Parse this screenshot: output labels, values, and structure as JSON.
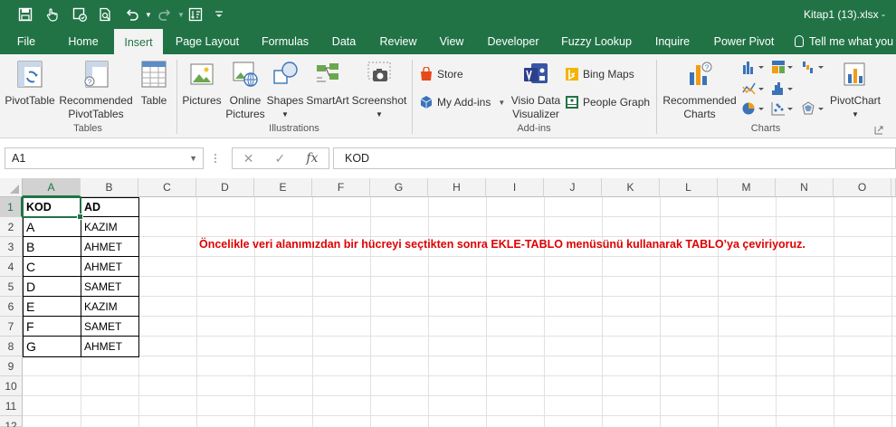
{
  "window": {
    "title": "Kitap1 (13).xlsx -"
  },
  "quick_access": {
    "icons": [
      "save-icon",
      "touch-mode-icon",
      "autosave-icon",
      "print-preview-icon",
      "undo-icon",
      "redo-icon",
      "sort-icon",
      "customize-icon"
    ]
  },
  "tabs": [
    {
      "label": "File"
    },
    {
      "label": "Home"
    },
    {
      "label": "Insert"
    },
    {
      "label": "Page Layout"
    },
    {
      "label": "Formulas"
    },
    {
      "label": "Data"
    },
    {
      "label": "Review"
    },
    {
      "label": "View"
    },
    {
      "label": "Developer"
    },
    {
      "label": "Fuzzy Lookup"
    },
    {
      "label": "Inquire"
    },
    {
      "label": "Power Pivot"
    }
  ],
  "tell_me": "Tell me what you",
  "ribbon": {
    "tables": {
      "label": "Tables",
      "pivottable": "PivotTable",
      "recommended_pivot_1": "Recommended",
      "recommended_pivot_2": "PivotTables",
      "table": "Table"
    },
    "illustrations": {
      "label": "Illustrations",
      "pictures": "Pictures",
      "online_1": "Online",
      "online_2": "Pictures",
      "shapes": "Shapes",
      "smartart": "SmartArt",
      "screenshot": "Screenshot"
    },
    "addins": {
      "label": "Add-ins",
      "store": "Store",
      "my_addins": "My Add-ins",
      "visio_1": "Visio Data",
      "visio_2": "Visualizer",
      "bing_maps": "Bing Maps",
      "people_graph": "People Graph"
    },
    "charts": {
      "label": "Charts",
      "recommended_1": "Recommended",
      "recommended_2": "Charts",
      "pivotchart": "PivotChart"
    }
  },
  "formula_bar": {
    "name_box": "A1",
    "fx": "fx",
    "content": "KOD"
  },
  "grid": {
    "columns": [
      "A",
      "B",
      "C",
      "D",
      "E",
      "F",
      "G",
      "H",
      "I",
      "J",
      "K",
      "L",
      "M",
      "N",
      "O"
    ],
    "rows": [
      "1",
      "2",
      "3",
      "4",
      "5",
      "6",
      "7",
      "8",
      "9",
      "10",
      "11",
      "12"
    ],
    "table": [
      {
        "a": "KOD",
        "b": "AD"
      },
      {
        "a": "A",
        "b": "KAZIM"
      },
      {
        "a": "B",
        "b": "AHMET"
      },
      {
        "a": "C",
        "b": "AHMET"
      },
      {
        "a": "D",
        "b": "SAMET"
      },
      {
        "a": "E",
        "b": "KAZIM"
      },
      {
        "a": "F",
        "b": "SAMET"
      },
      {
        "a": "G",
        "b": "AHMET"
      }
    ],
    "note": "Öncelikle veri alanımızdan bir hücreyi seçtikten sonra EKLE-TABLO menüsünü kullanarak TABLO’ya çeviriyoruz."
  },
  "colors": {
    "excel_green": "#217346",
    "note_red": "#e00000"
  }
}
